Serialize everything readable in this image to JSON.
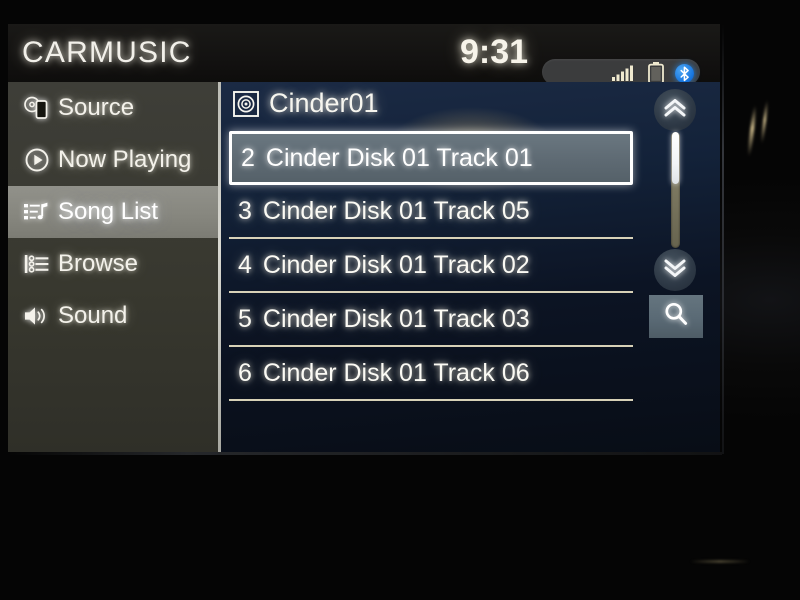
{
  "app": {
    "title": "CARMUSIC"
  },
  "statusbar": {
    "clock": "9:31",
    "signal_icon": "signal-bars-icon",
    "battery_icon": "battery-icon",
    "bluetooth_icon": "bluetooth-icon"
  },
  "sidebar": {
    "items": [
      {
        "label": "Source",
        "icon": "disc-device-icon",
        "active": false
      },
      {
        "label": "Now Playing",
        "icon": "play-circle-icon",
        "active": false
      },
      {
        "label": "Song List",
        "icon": "song-list-icon",
        "active": true
      },
      {
        "label": "Browse",
        "icon": "browse-list-icon",
        "active": false
      },
      {
        "label": "Sound",
        "icon": "speaker-icon",
        "active": false
      }
    ]
  },
  "content": {
    "folder_icon": "disc-icon",
    "folder_name": "Cinder01",
    "tracks": [
      {
        "number": "2",
        "title": "Cinder Disk 01 Track 01",
        "selected": true
      },
      {
        "number": "3",
        "title": "Cinder Disk 01 Track 05",
        "selected": false
      },
      {
        "number": "4",
        "title": "Cinder Disk 01 Track 02",
        "selected": false
      },
      {
        "number": "5",
        "title": "Cinder Disk 01 Track 03",
        "selected": false
      },
      {
        "number": "6",
        "title": "Cinder Disk 01 Track 06",
        "selected": false
      }
    ],
    "scroll": {
      "up_icon": "double-chevron-up-icon",
      "down_icon": "double-chevron-down-icon",
      "search_icon": "search-icon",
      "thumb_position_percent": 0,
      "thumb_size_percent": 45
    }
  },
  "colors": {
    "screen_bg": "#0b1018",
    "titlebar_bg": "#131211",
    "sidebar_bg": "#38382f",
    "sidebar_active_bg": "#87877f",
    "content_bg": "#0c1424",
    "selected_row_bg": "#5e6a73",
    "bluetooth_blue": "#1877e0",
    "text_cream": "#f6f5ef",
    "separator": "#e9e2c4"
  }
}
